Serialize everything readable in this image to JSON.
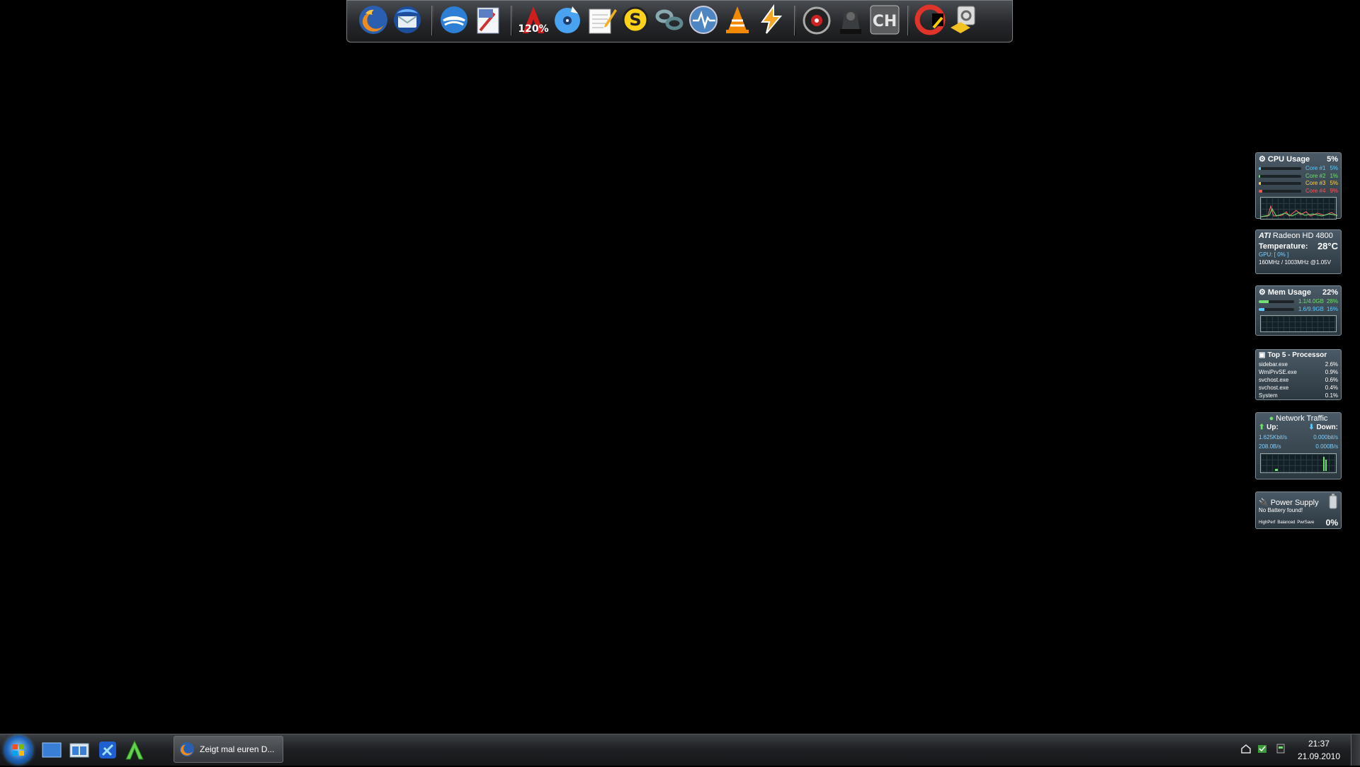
{
  "dock": {
    "icons": [
      "firefox-icon",
      "thunderbird-icon",
      "openoffice-icon",
      "paint-icon",
      "acrobat-icon",
      "burning-disc-icon",
      "notepad-icon",
      "skype-icon",
      "network-link-icon",
      "steam-icon",
      "vlc-icon",
      "winamp-icon",
      "game-ring-icon",
      "battlefield-icon",
      "ch-icon",
      "ccleaner-icon",
      "settings-tool-icon"
    ]
  },
  "gadgets": {
    "cpu": {
      "title": "CPU Usage",
      "value": "5%",
      "cores": [
        {
          "label": "Core #1",
          "value": "5%",
          "color": "#5ec8ff",
          "level": 0.05
        },
        {
          "label": "Core #2",
          "value": "1%",
          "color": "#6fe06f",
          "level": 0.01
        },
        {
          "label": "Core #3",
          "value": "5%",
          "color": "#ffcf50",
          "level": 0.05
        },
        {
          "label": "Core #4",
          "value": "9%",
          "color": "#ff5050",
          "level": 0.09
        }
      ]
    },
    "gpu": {
      "brand": "ATI",
      "title": "Radeon HD 4800",
      "temp_label": "Temperature:",
      "temp_value": "28°C",
      "gpu_load": "GPU: [ 0% ]",
      "clocks": "160MHz / 1003MHz @1.05V"
    },
    "mem": {
      "title": "Mem Usage",
      "value": "22%",
      "rows": [
        {
          "label": "1.1/4.0GB",
          "value": "28%",
          "level": 0.28,
          "color": "#6fe06f"
        },
        {
          "label": "1.6/9.9GB",
          "value": "16%",
          "level": 0.16,
          "color": "#5ec8ff"
        }
      ]
    },
    "top5": {
      "title": "Top 5 - Processor",
      "rows": [
        {
          "name": "sidebar.exe",
          "value": "2.6%"
        },
        {
          "name": "WmiPrvSE.exe",
          "value": "0.9%"
        },
        {
          "name": "svchost.exe",
          "value": "0.6%"
        },
        {
          "name": "svchost.exe",
          "value": "0.4%"
        },
        {
          "name": "System",
          "value": "0.1%"
        }
      ]
    },
    "network": {
      "title": "Network Traffic",
      "up_label": "Up:",
      "down_label": "Down:",
      "up_bits": "1.625Kbit/s",
      "down_bits": "0.000bit/s",
      "up_bytes": "208.0B/s",
      "down_bytes": "0.000B/s"
    },
    "power": {
      "title": "Power Supply",
      "status": "No Battery found!",
      "modes": [
        "HighPerf",
        "Balanced",
        "PwrSave"
      ],
      "percent": "0%"
    }
  },
  "taskbar": {
    "quick_launch": [
      "show-desktop-icon",
      "switch-windows-icon",
      "app-blue-icon",
      "app-green-a-icon"
    ],
    "task_label": "Zeigt mal euren D...",
    "clock_time": "21:37",
    "clock_date": "21.09.2010"
  },
  "colors": {
    "accent": "#1f63b8",
    "gadget_bg": "#3a4852",
    "up": "#6fe06f",
    "down": "#5ec8ff"
  }
}
